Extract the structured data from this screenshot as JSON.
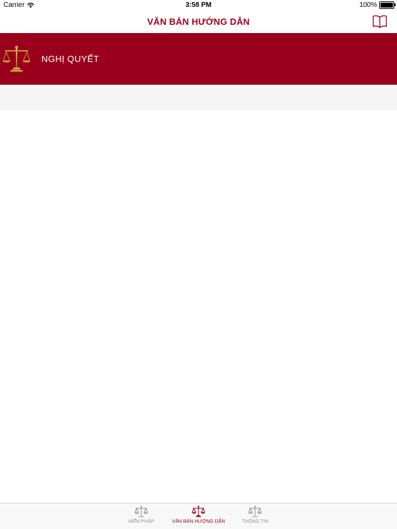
{
  "status_bar": {
    "carrier": "Carrier",
    "time": "3:58 PM",
    "battery": "100%",
    "battery_level": 1.0,
    "icons": [
      "wifi-icon",
      "battery-icon"
    ]
  },
  "nav": {
    "title": "VĂN BẢN HƯỚNG DẪN",
    "right_icon": "book-icon"
  },
  "banner": {
    "icon": "scales-of-justice-icon",
    "label": "NGHỊ QUYẾT"
  },
  "tabs": [
    {
      "label": "HIẾN PHÁP",
      "icon": "scales-icon",
      "active": false
    },
    {
      "label": "VĂN BẢN HƯỚNG DẪN",
      "icon": "scales-icon",
      "active": true
    },
    {
      "label": "THÔNG TIN",
      "icon": "scales-icon",
      "active": false
    }
  ],
  "colors": {
    "accent": "#9a001c",
    "title_red": "#a0001c",
    "tab_inactive": "#929292",
    "gold": "#c8962a"
  }
}
